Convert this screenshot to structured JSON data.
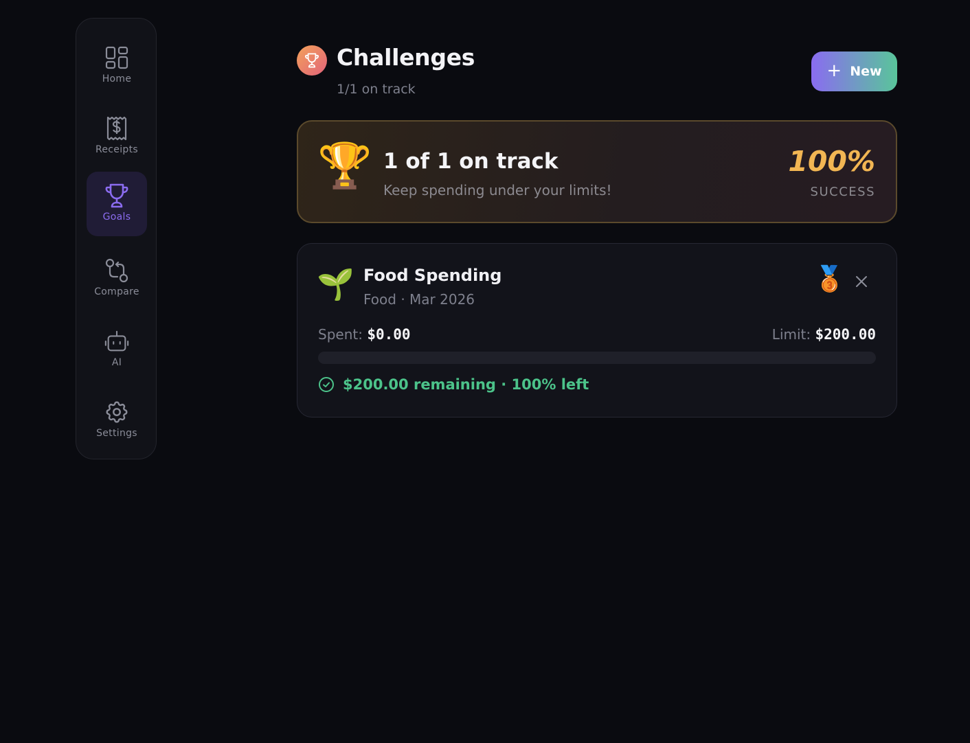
{
  "sidebar": {
    "items": [
      {
        "label": "Home",
        "icon": "home-grid-icon",
        "active": false
      },
      {
        "label": "Receipts",
        "icon": "receipt-dollar-icon",
        "active": false
      },
      {
        "label": "Goals",
        "icon": "trophy-icon",
        "active": true
      },
      {
        "label": "Compare",
        "icon": "compare-icon",
        "active": false
      },
      {
        "label": "AI",
        "icon": "robot-icon",
        "active": false
      },
      {
        "label": "Settings",
        "icon": "gear-icon",
        "active": false
      }
    ]
  },
  "header": {
    "title": "Challenges",
    "subtitle": "1/1 on track",
    "new_button_label": "New"
  },
  "summary": {
    "heading": "1 of 1 on track",
    "subtext": "Keep spending under your limits!",
    "success_value": "100%",
    "success_label": "SUCCESS"
  },
  "challenges": [
    {
      "emoji": "🌱",
      "name": "Food Spending",
      "meta": "Food · Mar 2026",
      "medal": "🥉",
      "spent_label": "Spent:",
      "spent_value": "$0.00",
      "limit_label": "Limit:",
      "limit_value": "$200.00",
      "progress_fraction": 0.0,
      "remaining_text": "$200.00 remaining · 100% left"
    }
  ],
  "colors": {
    "accent_purple": "#8b6cf0",
    "success_green": "#4cc38a",
    "gold": "#f2b653"
  }
}
